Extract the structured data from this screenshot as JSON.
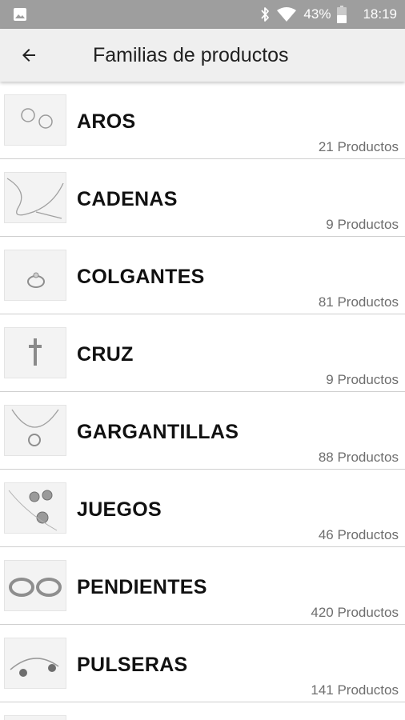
{
  "status_bar": {
    "battery": "43%",
    "time": "18:19",
    "icons": [
      "gallery-icon",
      "bluetooth-icon",
      "wifi-icon",
      "battery-icon"
    ]
  },
  "app_bar": {
    "title": "Familias de productos",
    "back_icon": "arrow-left-icon"
  },
  "families": [
    {
      "name": "AROS",
      "count": "21 Productos"
    },
    {
      "name": "CADENAS",
      "count": "9 Productos"
    },
    {
      "name": "COLGANTES",
      "count": "81 Productos"
    },
    {
      "name": "CRUZ",
      "count": "9 Productos"
    },
    {
      "name": "GARGANTILLAS",
      "count": "88 Productos"
    },
    {
      "name": "JUEGOS",
      "count": "46 Productos"
    },
    {
      "name": "PENDIENTES",
      "count": "420 Productos"
    },
    {
      "name": "PULSERAS",
      "count": "141 Productos"
    }
  ],
  "colors": {
    "status_bar": "#9e9e9e",
    "app_bar": "#efefef",
    "divider": "#cfcfcf",
    "count_text": "#6e6e6e"
  }
}
